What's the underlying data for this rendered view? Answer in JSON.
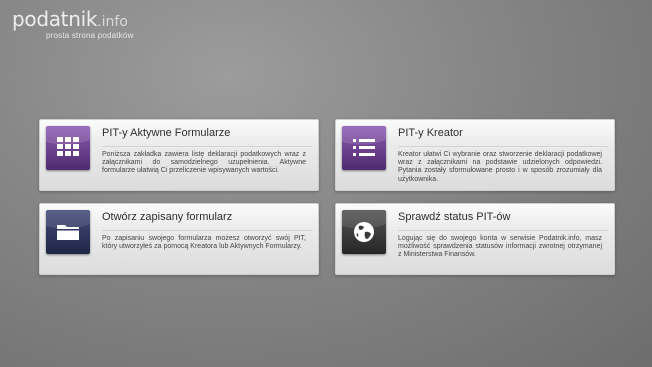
{
  "logo": {
    "name": "podatnik",
    "suffix": ".info",
    "tagline": "prosta strona podatków"
  },
  "tiles": [
    {
      "title": "PIT-y Aktywne Formularze",
      "description": "Poniższa zakładka zawiera listę deklaracji podatkowych wraz z załącznikami do samodzielnego uzupełnienia. Aktywne formularze ułatwią Ci przeliczenie wpisywanych wartości.",
      "icon": "grid-table-icon",
      "color": "#6a3b8e"
    },
    {
      "title": "PIT-y Kreator",
      "description": "Kreator ułatwi Ci wybranie oraz stworzenie deklaracji podatkowej wraz z załącznikami na podstawie udzielonych odpowiedzi. Pytania zostały sformułowane prosto i w sposób zrozumiały dla użytkownika.",
      "icon": "list-icon",
      "color": "#6a3b8e"
    },
    {
      "title": "Otwórz zapisany formularz",
      "description": "Po zapisaniu swojego formularza możesz otworzyć swój PIT, który utworzyłeś za pomocą Kreatora lub Aktywnych Formularzy.",
      "icon": "folder-icon",
      "color": "#2f3760"
    },
    {
      "title": "Sprawdź status PIT-ów",
      "description": "Logując się do swojego konta w serwisie Podatnik.info, masz możliwość sprawdzenia statusów informacji zwrotnej otrzymanej z Ministerstwa Finansów.",
      "icon": "globe-icon",
      "color": "#3a3a3a"
    }
  ]
}
